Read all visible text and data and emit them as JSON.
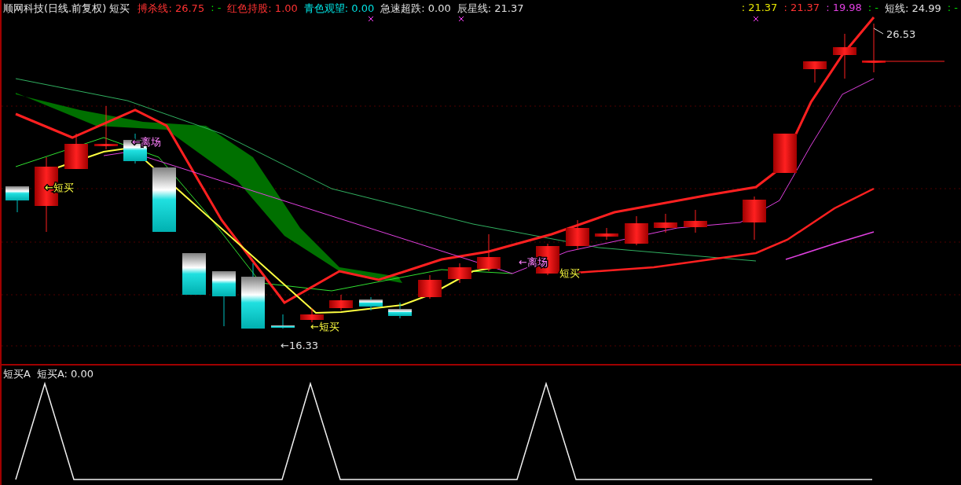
{
  "chart_header": {
    "title": "顺网科技(日线.前复权) 短买",
    "legend_left": [
      {
        "text": "搏杀线: 26.75",
        "color": "#ff3232"
      },
      {
        "text": ": -",
        "color": "#00e000"
      },
      {
        "text": "红色持股: 1.00",
        "color": "#ff3232"
      },
      {
        "text": "青色观望: 0.00",
        "color": "#00e0e0"
      },
      {
        "text": "急速超跌: 0.00",
        "color": "#e0e0e0"
      },
      {
        "text": "辰星线: 21.37",
        "color": "#e0e0e0"
      }
    ],
    "legend_right": [
      {
        "text": ": 21.37",
        "color": "#e8e800"
      },
      {
        "text": ": 21.37",
        "color": "#ff3232"
      },
      {
        "text": ": 19.98",
        "color": "#e040e0"
      },
      {
        "text": ": -",
        "color": "#00e000"
      },
      {
        "text": "短线: 24.99",
        "color": "#e0e0e0"
      },
      {
        "text": ": -",
        "color": "#00e000"
      }
    ]
  },
  "annotations": [
    {
      "text": "←离场",
      "color": "#ff80ff"
    },
    {
      "text": "←短买",
      "color": "#ffff40"
    },
    {
      "text": "←短买",
      "color": "#ffff40"
    },
    {
      "text": "←16.33",
      "color": "#e0e0e0"
    },
    {
      "text": "←离场",
      "color": "#ff80ff"
    },
    {
      "text": "短买",
      "color": "#ffff40"
    },
    {
      "text": "26.53",
      "color": "#e0e0e0"
    }
  ],
  "indicator_panel": {
    "name": "短买A",
    "reading": "短买A: 0.00"
  }
}
